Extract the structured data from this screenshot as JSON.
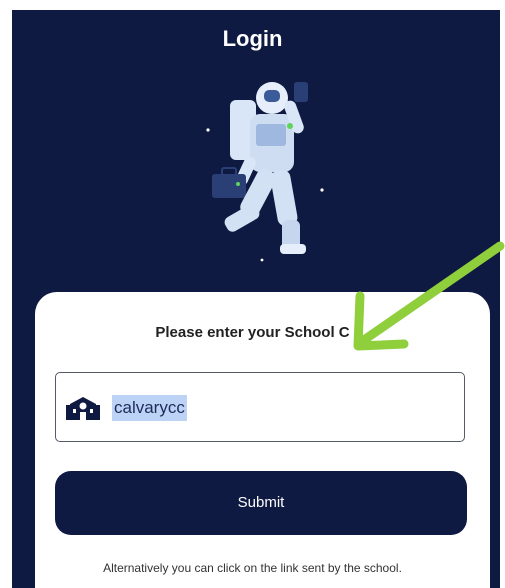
{
  "header": {
    "title": "Login"
  },
  "illustration": {
    "name": "astronaut-illustration"
  },
  "form": {
    "prompt": "Please enter your School C",
    "school_code_value": "calvarycc",
    "school_icon": "school-building-icon",
    "submit_label": "Submit",
    "alternative_text": "Alternatively you can click on the link sent by the school."
  },
  "annotation": {
    "arrow_icon": "green-arrow-icon"
  },
  "colors": {
    "background": "#0f1a42",
    "button": "#0f1a42",
    "selection_highlight": "#bcd3f5",
    "annotation_arrow": "#8fcf3c"
  }
}
